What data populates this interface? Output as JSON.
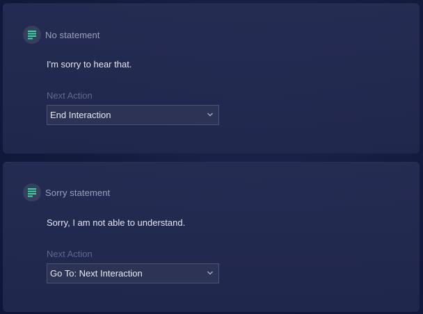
{
  "cards": [
    {
      "title": "No statement",
      "icon": "statement-icon",
      "message": "I'm sorry to hear that.",
      "next_action_label": "Next Action",
      "next_action_value": "End Interaction"
    },
    {
      "title": "Sorry statement",
      "icon": "statement-icon",
      "message": "Sorry, I am not able to understand.",
      "next_action_label": "Next Action",
      "next_action_value": "Go To: Next Interaction"
    }
  ],
  "colors": {
    "icon_accent": "#3ed6a0",
    "card_background": "#262d54",
    "page_background": "#141a3c"
  }
}
